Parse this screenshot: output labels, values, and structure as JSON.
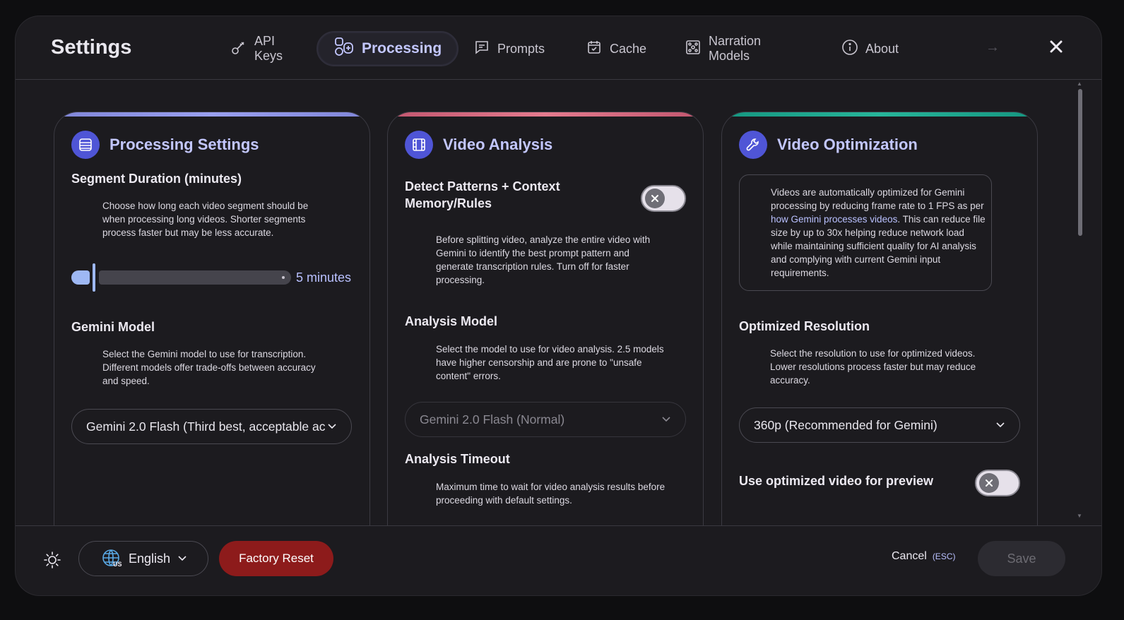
{
  "header": {
    "title": "Settings",
    "tabs": [
      {
        "label": "API Keys",
        "icon": "key-icon"
      },
      {
        "label": "Processing",
        "icon": "processing-icon",
        "active": true
      },
      {
        "label": "Prompts",
        "icon": "chat-icon"
      },
      {
        "label": "Cache",
        "icon": "calendar-check-icon"
      },
      {
        "label": "Narration Models",
        "icon": "model-icon"
      },
      {
        "label": "About",
        "icon": "info-icon"
      }
    ]
  },
  "cards": {
    "processing": {
      "title": "Processing Settings",
      "segment_label": "Segment Duration (minutes)",
      "segment_desc": "Choose how long each video segment should be when processing long videos. Shorter segments process faster but may be less accurate.",
      "segment_value": "5 minutes",
      "segment_fraction": 0.0,
      "model_label": "Gemini Model",
      "model_desc": "Select the Gemini model to use for transcription. Different models offer trade-offs between accuracy and speed.",
      "model_value": "Gemini 2.0 Flash (Third best, acceptable ac"
    },
    "analysis": {
      "title": "Video Analysis",
      "detect_label": "Detect Patterns + Context Memory/Rules",
      "detect_enabled": false,
      "detect_desc": "Before splitting video, analyze the entire video with Gemini to identify the best prompt pattern and generate transcription rules. Turn off for faster processing.",
      "model_label": "Analysis Model",
      "model_desc": "Select the model to use for video analysis. 2.5 models have higher censorship and are prone to \"unsafe content\" errors.",
      "model_value": "Gemini 2.0 Flash (Normal)",
      "timeout_label": "Analysis Timeout",
      "timeout_desc": "Maximum time to wait for video analysis results before proceeding with default settings."
    },
    "optimization": {
      "title": "Video Optimization",
      "info_before": "Videos are automatically optimized for Gemini processing by reducing frame rate to 1 FPS as per ",
      "info_link": "how Gemini processes videos",
      "info_after": ". This can reduce file size by up to 30x helping reduce network load while maintaining sufficient quality for AI analysis and complying with current Gemini input requirements.",
      "resolution_label": "Optimized Resolution",
      "resolution_desc": "Select the resolution to use for optimized videos. Lower resolutions process faster but may reduce accuracy.",
      "resolution_value": "360p (Recommended for Gemini)",
      "preview_label": "Use optimized video for preview",
      "preview_enabled": false
    }
  },
  "footer": {
    "language": "English",
    "language_flag_sub": "US",
    "factory_reset": "Factory Reset",
    "cancel": "Cancel",
    "cancel_shortcut": "(ESC)",
    "save": "Save"
  },
  "colors": {
    "accent": "#c3c7ff",
    "danger": "#8d1b1b",
    "card1_top": "#9aa0f0",
    "card2_top": "#e47b8e",
    "card3_top": "#27b59a"
  }
}
